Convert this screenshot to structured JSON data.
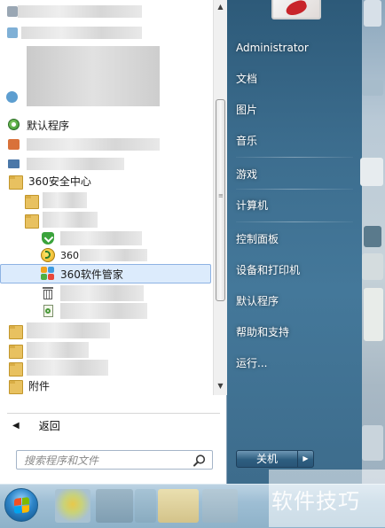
{
  "programs": {
    "default_programs": "默认程序",
    "folder_360": "360安全中心",
    "item_360_guard_partial": "360",
    "item_360_manager": "360软件管家",
    "attachments": "附件"
  },
  "back_label": "返回",
  "search": {
    "placeholder": "搜索程序和文件"
  },
  "right_links": {
    "user": "Administrator",
    "documents": "文档",
    "pictures": "图片",
    "music": "音乐",
    "games": "游戏",
    "computer": "计算机",
    "control_panel": "控制面板",
    "devices_printers": "设备和打印机",
    "default_programs": "默认程序",
    "help_support": "帮助和支持",
    "run": "运行..."
  },
  "shutdown_label": "关机",
  "watermark": "软件技巧",
  "icons": {
    "back": "arrow-left-icon",
    "search": "magnifier-icon",
    "shutdown_arrow": "triangle-right-icon",
    "start": "windows-orb-icon"
  }
}
